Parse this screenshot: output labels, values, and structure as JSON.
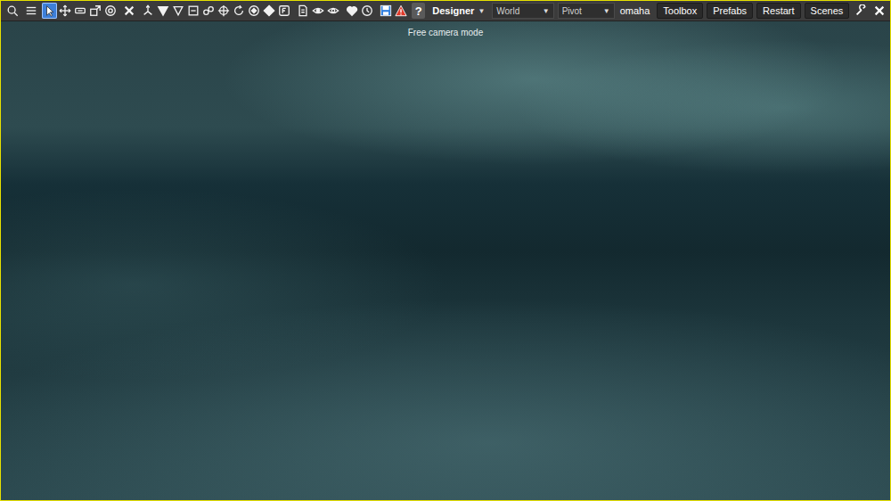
{
  "toolbar": {
    "tool_groups": [
      [
        {
          "kind": "search",
          "selected": false
        }
      ],
      [
        {
          "kind": "list",
          "selected": false
        }
      ],
      [
        {
          "kind": "select",
          "selected": true
        },
        {
          "kind": "move",
          "selected": false
        },
        {
          "kind": "rect",
          "selected": false
        },
        {
          "kind": "scale",
          "selected": false
        },
        {
          "kind": "circle",
          "selected": false
        }
      ],
      [
        {
          "kind": "delete",
          "selected": false
        }
      ],
      [
        {
          "kind": "gizmo",
          "selected": false
        },
        {
          "kind": "drop",
          "selected": false
        },
        {
          "kind": "drop-outline",
          "selected": false
        },
        {
          "kind": "box",
          "selected": false
        },
        {
          "kind": "link",
          "selected": false
        },
        {
          "kind": "target",
          "selected": false
        },
        {
          "kind": "rotate",
          "selected": false
        },
        {
          "kind": "orbit",
          "selected": false
        },
        {
          "kind": "diamond",
          "selected": false
        },
        {
          "kind": "snap",
          "selected": false
        }
      ],
      [
        {
          "kind": "page",
          "selected": false
        },
        {
          "kind": "eye",
          "selected": false
        },
        {
          "kind": "eye-off",
          "selected": false
        }
      ],
      [
        {
          "kind": "heart",
          "selected": false
        },
        {
          "kind": "clock",
          "selected": false
        }
      ],
      [
        {
          "kind": "save",
          "selected": false
        },
        {
          "kind": "warning",
          "selected": false
        }
      ]
    ],
    "help": "?",
    "mode": {
      "label": "Designer",
      "arrow": "▼"
    },
    "dropdowns": [
      {
        "value": "World",
        "arrow": "▼"
      },
      {
        "value": "Pivot",
        "arrow": "▼"
      }
    ],
    "user": "omaha",
    "buttons": [
      "Toolbox",
      "Prefabs",
      "Restart",
      "Scenes"
    ]
  },
  "viewport": {
    "status": "Free camera mode"
  }
}
